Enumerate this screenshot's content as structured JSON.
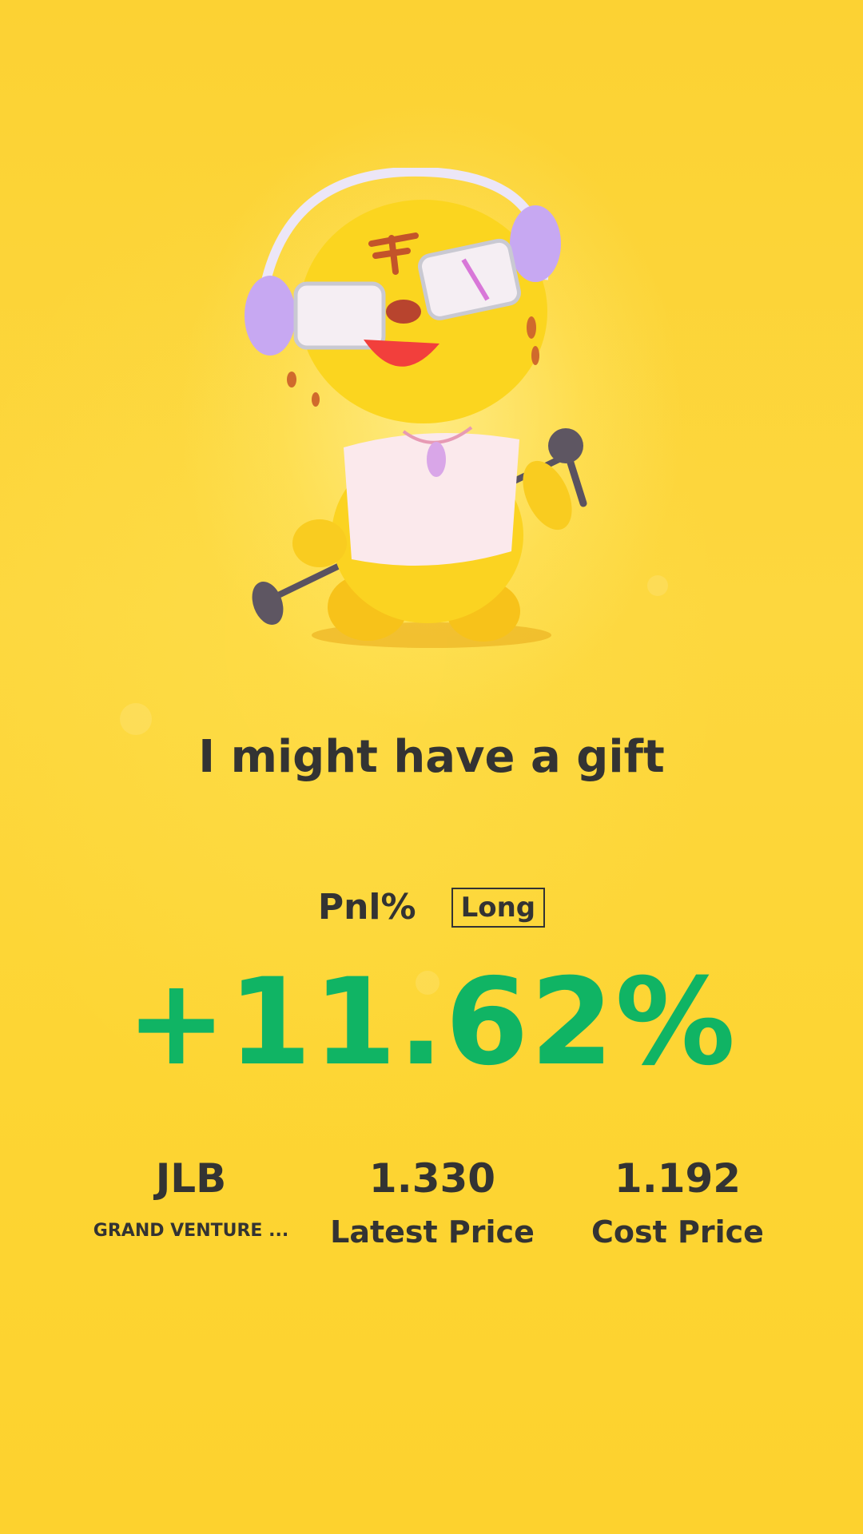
{
  "headline": "I might have a gift",
  "pnl": {
    "label": "Pnl%",
    "direction": "Long",
    "value": "+11.62%",
    "value_color": "#10b464"
  },
  "stock": {
    "symbol": "JLB",
    "name": "GRAND VENTURE ..."
  },
  "latest": {
    "value": "1.330",
    "label": "Latest Price"
  },
  "cost": {
    "value": "1.192",
    "label": "Cost Price"
  },
  "colors": {
    "background": "#fdd533",
    "text": "#333333",
    "gain": "#10b464"
  },
  "icons": {
    "mascot": "tiger-mascot-illustration"
  }
}
